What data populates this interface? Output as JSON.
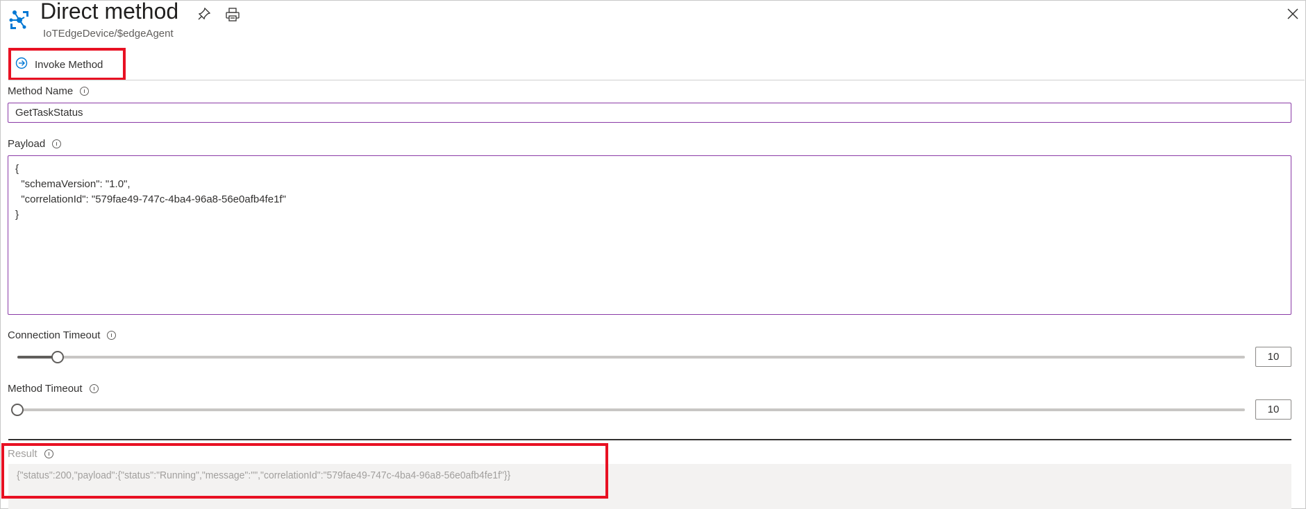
{
  "header": {
    "title": "Direct method",
    "subtitle": "IoTEdgeDevice/$edgeAgent",
    "icons": {
      "app": "iot-hub-device-icon",
      "pin": "pin-icon",
      "print": "print-icon",
      "close": "close-icon"
    }
  },
  "toolbar": {
    "invoke_label": "Invoke Method",
    "invoke_icon": "arrow-circle-right-icon"
  },
  "form": {
    "method_name": {
      "label": "Method Name",
      "value": "GetTaskStatus"
    },
    "payload": {
      "label": "Payload",
      "value": "{\n  \"schemaVersion\": \"1.0\",\n  \"correlationId\": \"579fae49-747c-4ba4-96a8-56e0afb4fe1f\"\n}"
    },
    "connection_timeout": {
      "label": "Connection Timeout",
      "value": "10",
      "slider_fraction": 0.033
    },
    "method_timeout": {
      "label": "Method Timeout",
      "value": "10",
      "slider_fraction": 0.0
    }
  },
  "result": {
    "label": "Result",
    "value": "{\"status\":200,\"payload\":{\"status\":\"Running\",\"message\":\"\",\"correlationId\":\"579fae49-747c-4ba4-96a8-56e0afb4fe1f\"}}"
  },
  "colors": {
    "accent": "#0078d4",
    "highlight_box": "#e81123",
    "input_border_focus": "#8a3aa6"
  }
}
